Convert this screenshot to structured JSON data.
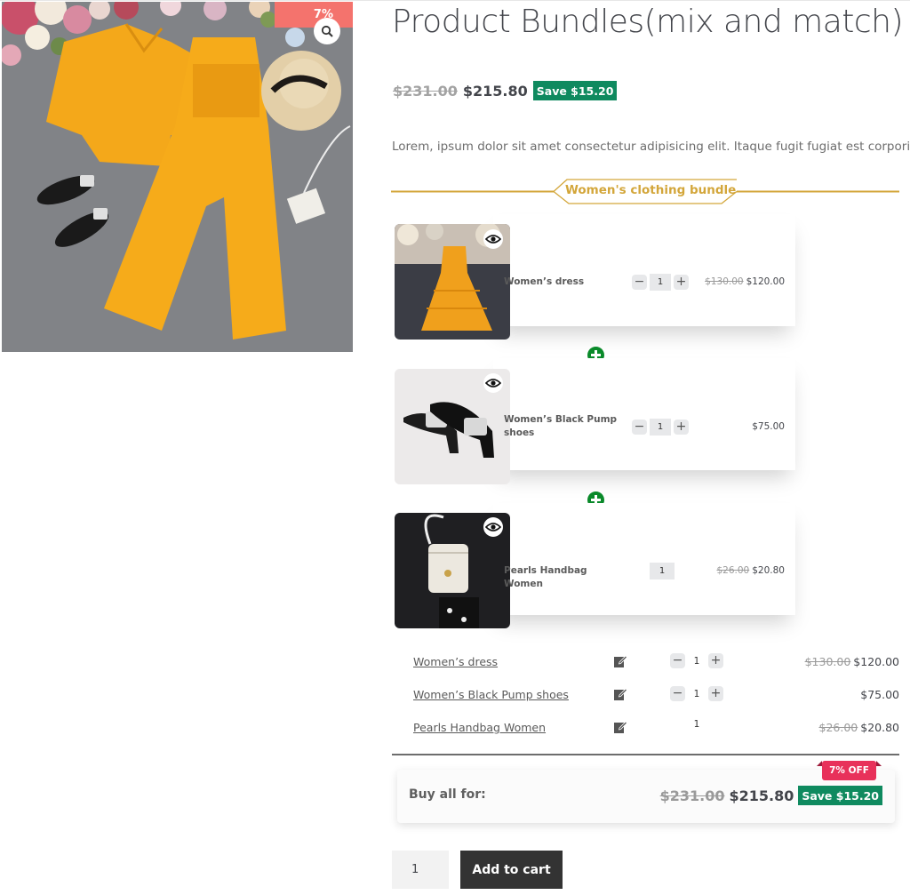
{
  "product": {
    "title": "Product Bundles(mix and match)",
    "sale_tab": "7%",
    "price_old": "$231.00",
    "price_new": "$215.80",
    "save": "Save $15.20",
    "description": "Lorem, ipsum dolor sit amet consectetur adipisicing elit. Itaque fugit fugiat est corporis."
  },
  "bundle": {
    "title": "Women's clothing bundle",
    "accent_color": "#d3a63a",
    "items": [
      {
        "name": "Women’s dress",
        "qty": "1",
        "price_old": "$130.00",
        "price": "$120.00",
        "stepper": true
      },
      {
        "name": "Women’s Black Pump shoes",
        "qty": "1",
        "price_old": "",
        "price": "$75.00",
        "stepper": true
      },
      {
        "name": "Pearls Handbag Women",
        "qty": "1",
        "price_old": "$26.00",
        "price": "$20.80",
        "stepper": false
      }
    ]
  },
  "summary": {
    "items": [
      {
        "name": "Women’s dress",
        "qty": "1",
        "price_old": "$130.00",
        "price": "$120.00"
      },
      {
        "name": "Women’s Black Pump shoes",
        "qty": "1",
        "price_old": "",
        "price": "$75.00"
      },
      {
        "name": "Pearls Handbag Women",
        "qty": "1",
        "price_old": "$26.00",
        "price": "$20.80"
      }
    ]
  },
  "buy_all": {
    "label": "Buy all for:",
    "price_old": "$231.00",
    "price_new": "$215.80",
    "save": "Save $15.20",
    "off_badge": "7% OFF"
  },
  "cart": {
    "qty": "1",
    "button": "Add to cart"
  },
  "stepper": {
    "minus": "−",
    "plus": "+"
  },
  "icons": [
    "search-icon",
    "eye-icon",
    "plus-circle-icon",
    "edit-icon"
  ],
  "colors": {
    "save_green": "#0f8a5f",
    "sale_red": "#f4736d",
    "off_red": "#e8315a",
    "button_dark": "#333333"
  }
}
